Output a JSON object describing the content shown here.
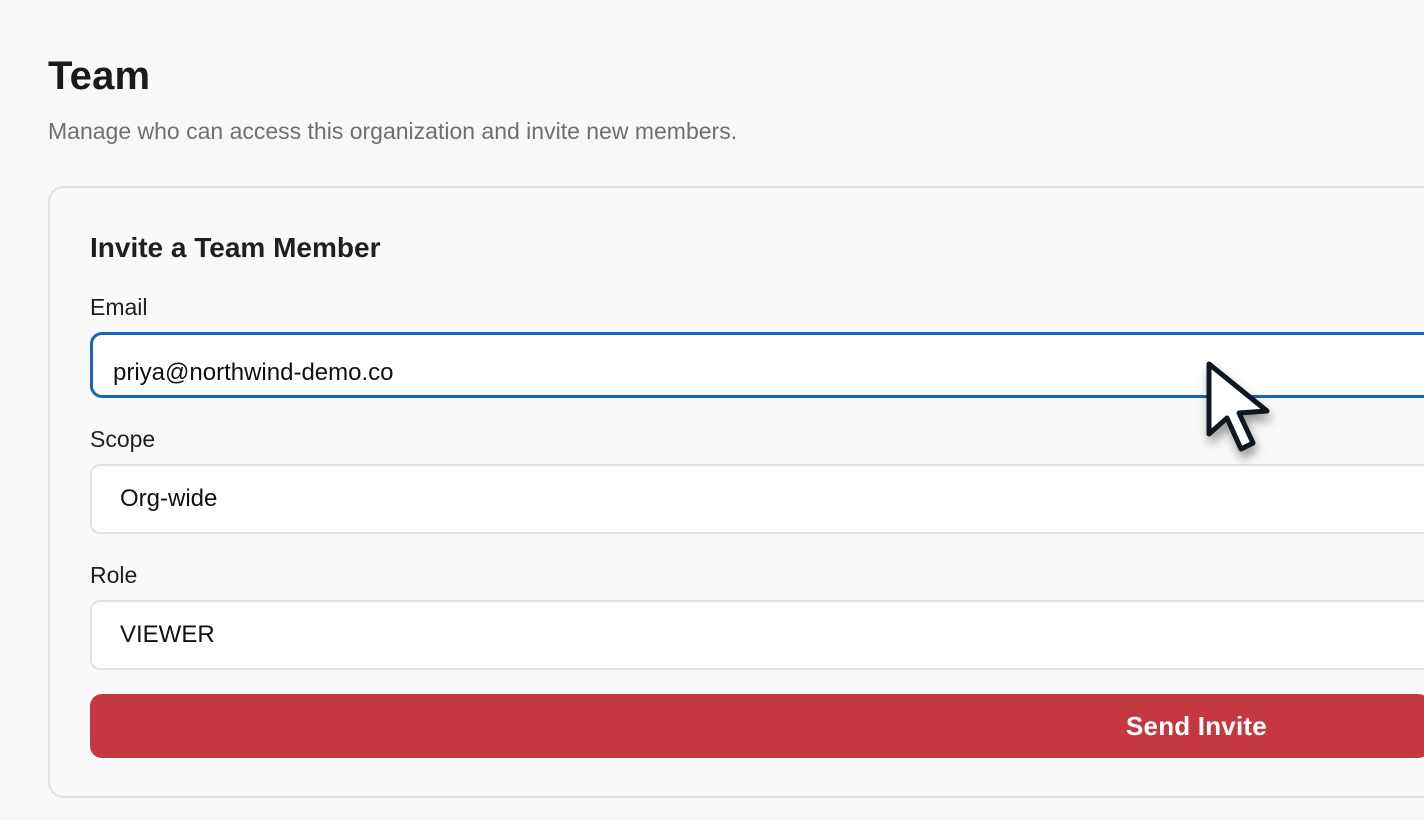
{
  "page": {
    "title": "Team",
    "subtitle": "Manage who can access this organization and invite new members."
  },
  "invite_card": {
    "title": "Invite a Team Member",
    "email": {
      "label": "Email",
      "value": "priya@northwind-demo.co",
      "placeholder": ""
    },
    "scope": {
      "label": "Scope",
      "selected": "Org-wide"
    },
    "role": {
      "label": "Role",
      "selected": "VIEWER"
    },
    "submit_label": "Send Invite"
  },
  "colors": {
    "accent_focus": "#1565c0",
    "button_primary": "#c43842"
  },
  "icons": {
    "cursor": "mouse-pointer-icon"
  }
}
